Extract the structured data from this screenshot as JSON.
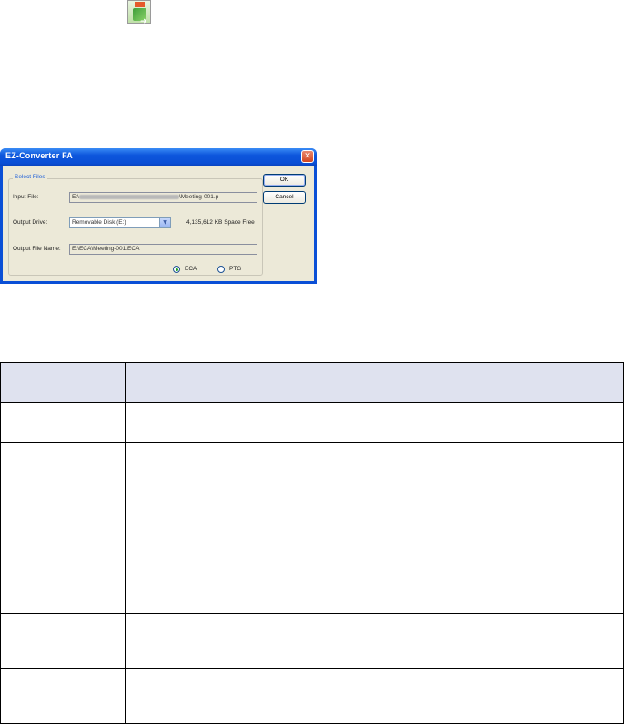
{
  "dialog": {
    "title": "EZ-Converter FA",
    "group_label": "Select Files",
    "input_file_label": "Input File:",
    "input_file_prefix": "E:\\",
    "input_file_suffix": "\\Meeting-001.p",
    "output_drive_label": "Output Drive:",
    "output_drive_value": "Removable Disk (E:)",
    "space_free": "4,135,612 KB Space Free",
    "output_file_label": "Output File Name:",
    "output_file_value": "E:\\ECA\\Meeting-001.ECA",
    "radio_eca": "ECA",
    "radio_ptg": "PTG",
    "ok_label": "OK",
    "cancel_label": "Cancel",
    "selected_format": "ECA"
  }
}
